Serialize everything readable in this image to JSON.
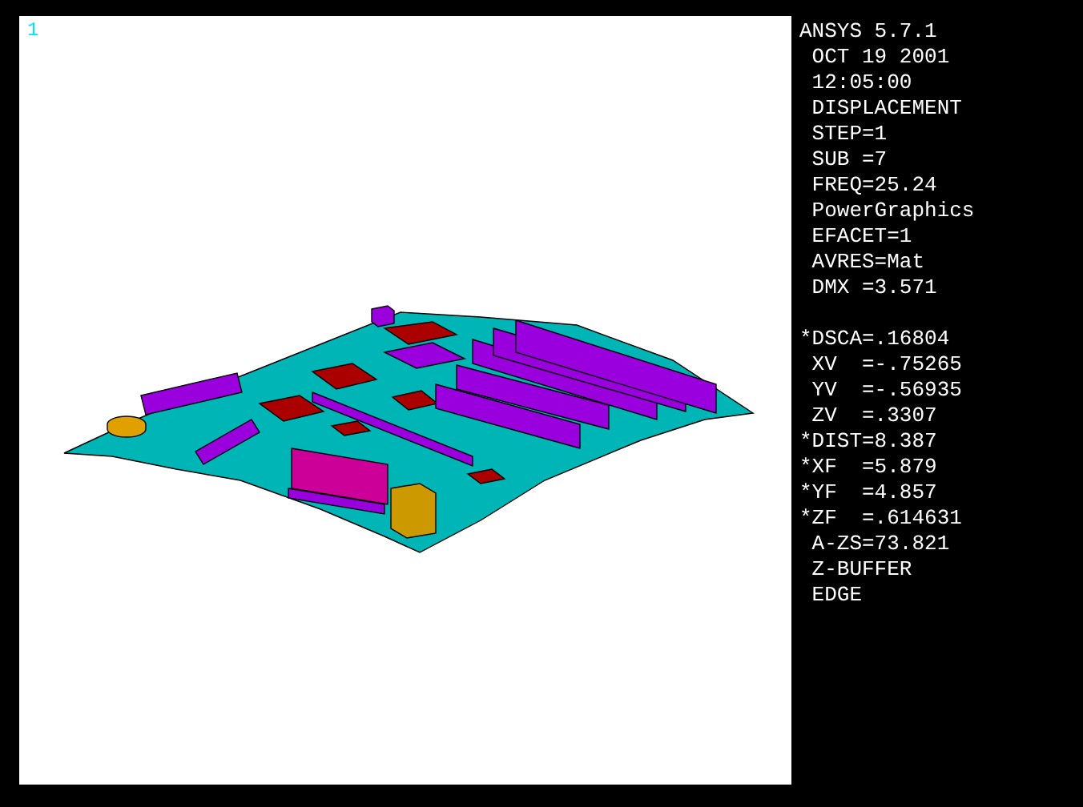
{
  "viewport": {
    "window_number": "1"
  },
  "legend_groups": [
    [
      "ANSYS 5.7.1",
      " OCT 19 2001",
      " 12:05:00",
      " DISPLACEMENT",
      " STEP=1",
      " SUB =7",
      " FREQ=25.24",
      " PowerGraphics",
      " EFACET=1",
      " AVRES=Mat",
      " DMX =3.571"
    ],
    [
      "*DSCA=.16804",
      " XV  =-.75265",
      " YV  =-.56935",
      " ZV  =.3307",
      "*DIST=8.387",
      "*XF  =5.879",
      "*YF  =4.857",
      "*ZF  =.614631",
      " A-ZS=73.821",
      " Z-BUFFER",
      " EDGE"
    ]
  ]
}
